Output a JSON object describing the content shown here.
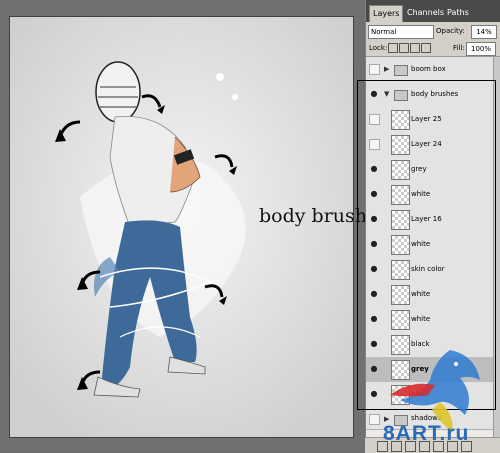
{
  "annotation": "body brushes",
  "panel": {
    "tabs": [
      "Layers",
      "Channels",
      "Paths"
    ],
    "blend_mode": "Normal",
    "opacity_label": "Opacity:",
    "opacity_value": "14%",
    "lock_label": "Lock:",
    "fill_label": "Fill:",
    "fill_value": "100%"
  },
  "layers": [
    {
      "name": "boom box",
      "type": "group",
      "visible": false,
      "expanded": false
    },
    {
      "name": "body brushes",
      "type": "group",
      "visible": true,
      "expanded": true
    },
    {
      "name": "Layer 25",
      "type": "layer",
      "visible": false
    },
    {
      "name": "Layer 24",
      "type": "layer",
      "visible": false
    },
    {
      "name": "grey",
      "type": "layer",
      "visible": true
    },
    {
      "name": "white",
      "type": "layer",
      "visible": true
    },
    {
      "name": "Layer 16",
      "type": "layer",
      "visible": true
    },
    {
      "name": "white",
      "type": "layer",
      "visible": true
    },
    {
      "name": "skin color",
      "type": "layer",
      "visible": true
    },
    {
      "name": "white",
      "type": "layer",
      "visible": true
    },
    {
      "name": "white",
      "type": "layer",
      "visible": true
    },
    {
      "name": "black",
      "type": "layer",
      "visible": true
    },
    {
      "name": "grey",
      "type": "layer",
      "visible": true,
      "selected": true
    },
    {
      "name": "blue",
      "type": "layer",
      "visible": true
    },
    {
      "name": "shadows",
      "type": "group",
      "visible": false
    }
  ],
  "watermark": "8ART.ru"
}
